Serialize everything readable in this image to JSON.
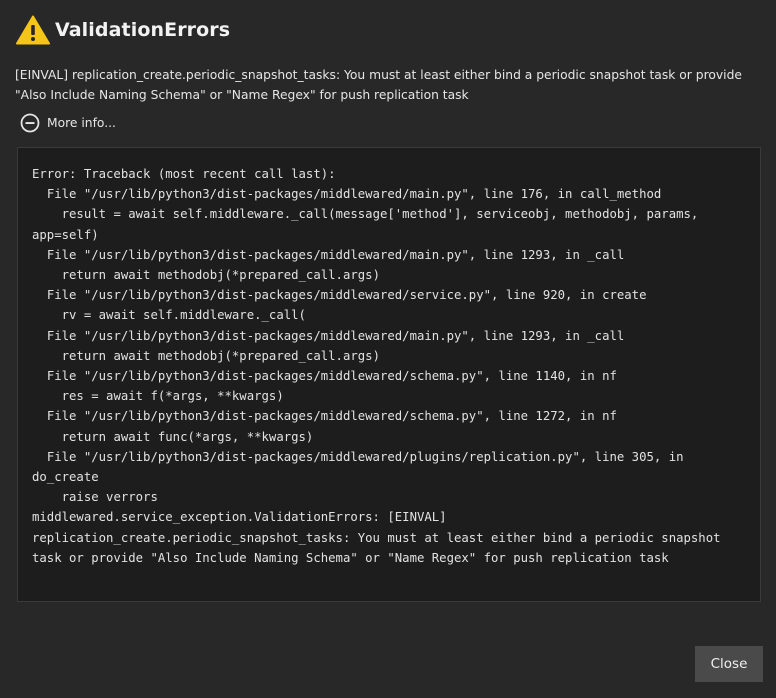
{
  "dialog": {
    "title": "ValidationErrors",
    "icon": "warning-icon",
    "accent_color": "#f5c518",
    "message": "[EINVAL] replication_create.periodic_snapshot_tasks: You must at least either bind a periodic snapshot task or provide \"Also Include Naming Schema\" or \"Name Regex\" for push replication task",
    "more_info_label": "More info...",
    "more_info_icon": "minus-circle-icon",
    "traceback": "Error: Traceback (most recent call last):\n  File \"/usr/lib/python3/dist-packages/middlewared/main.py\", line 176, in call_method\n    result = await self.middleware._call(message['method'], serviceobj, methodobj, params, app=self)\n  File \"/usr/lib/python3/dist-packages/middlewared/main.py\", line 1293, in _call\n    return await methodobj(*prepared_call.args)\n  File \"/usr/lib/python3/dist-packages/middlewared/service.py\", line 920, in create\n    rv = await self.middleware._call(\n  File \"/usr/lib/python3/dist-packages/middlewared/main.py\", line 1293, in _call\n    return await methodobj(*prepared_call.args)\n  File \"/usr/lib/python3/dist-packages/middlewared/schema.py\", line 1140, in nf\n    res = await f(*args, **kwargs)\n  File \"/usr/lib/python3/dist-packages/middlewared/schema.py\", line 1272, in nf\n    return await func(*args, **kwargs)\n  File \"/usr/lib/python3/dist-packages/middlewared/plugins/replication.py\", line 305, in do_create\n    raise verrors\nmiddlewared.service_exception.ValidationErrors: [EINVAL] replication_create.periodic_snapshot_tasks: You must at least either bind a periodic snapshot task or provide \"Also Include Naming Schema\" or \"Name Regex\" for push replication task",
    "close_label": "Close"
  }
}
